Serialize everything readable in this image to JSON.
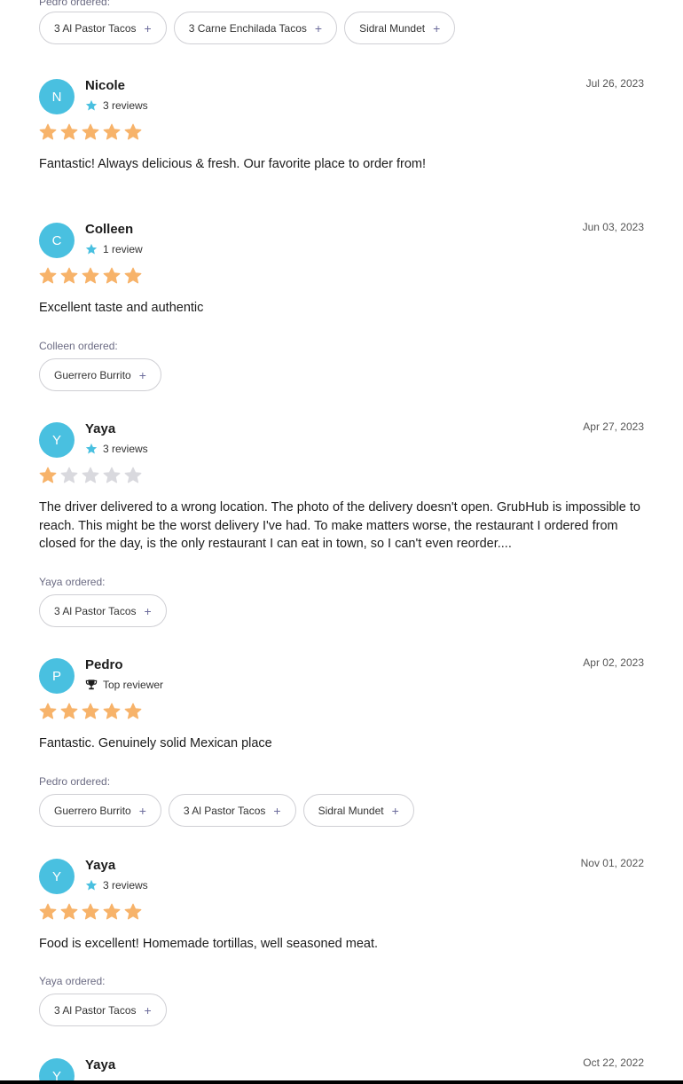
{
  "top_partial": {
    "ordered_label": "Pedro ordered:",
    "items": [
      "3 Al Pastor Tacos",
      "3 Carne Enchilada Tacos",
      "Sidral Mundet"
    ]
  },
  "colors": {
    "avatar": "#49c0e0",
    "star_on": "#f7b36a",
    "star_off": "#d9d9de",
    "meta_star": "#49c0e0"
  },
  "icons": {
    "add": "plus-icon",
    "reviews": "star-icon",
    "top_reviewer": "trophy-icon",
    "rating": "rating-star-icon"
  },
  "reviews": [
    {
      "initial": "N",
      "name": "Nicole",
      "meta": "3 reviews",
      "meta_icon": "star",
      "date": "Jul 26, 2023",
      "rating": 5,
      "text": "Fantastic! Always delicious & fresh. Our favorite place to order from!",
      "ordered_label": "",
      "items": []
    },
    {
      "initial": "C",
      "name": "Colleen",
      "meta": "1 review",
      "meta_icon": "star",
      "date": "Jun 03, 2023",
      "rating": 5,
      "text": "Excellent taste and authentic",
      "ordered_label": "Colleen ordered:",
      "items": [
        "Guerrero Burrito"
      ]
    },
    {
      "initial": "Y",
      "name": "Yaya",
      "meta": "3 reviews",
      "meta_icon": "star",
      "date": "Apr 27, 2023",
      "rating": 1,
      "text": "The driver delivered to a wrong location. The photo of the delivery doesn't open. GrubHub is impossible to reach. This might be the worst delivery I've had. To make matters worse, the restaurant I ordered from closed for the day, is the only restaurant I can eat in town, so I can't even reorder....",
      "ordered_label": "Yaya ordered:",
      "items": [
        "3 Al Pastor Tacos"
      ]
    },
    {
      "initial": "P",
      "name": "Pedro",
      "meta": "Top reviewer",
      "meta_icon": "trophy",
      "date": "Apr 02, 2023",
      "rating": 5,
      "text": "Fantastic. Genuinely solid Mexican place",
      "ordered_label": "Pedro ordered:",
      "items": [
        "Guerrero Burrito",
        "3 Al Pastor Tacos",
        "Sidral Mundet"
      ]
    },
    {
      "initial": "Y",
      "name": "Yaya",
      "meta": "3 reviews",
      "meta_icon": "star",
      "date": "Nov 01, 2022",
      "rating": 5,
      "text": "Food is excellent! Homemade tortillas, well seasoned meat.",
      "ordered_label": "Yaya ordered:",
      "items": [
        "3 Al Pastor Tacos"
      ]
    },
    {
      "initial": "Y",
      "name": "Yaya",
      "meta": "",
      "meta_icon": "",
      "date": "Oct 22, 2022",
      "rating": 0,
      "text": "",
      "ordered_label": "",
      "items": []
    }
  ]
}
